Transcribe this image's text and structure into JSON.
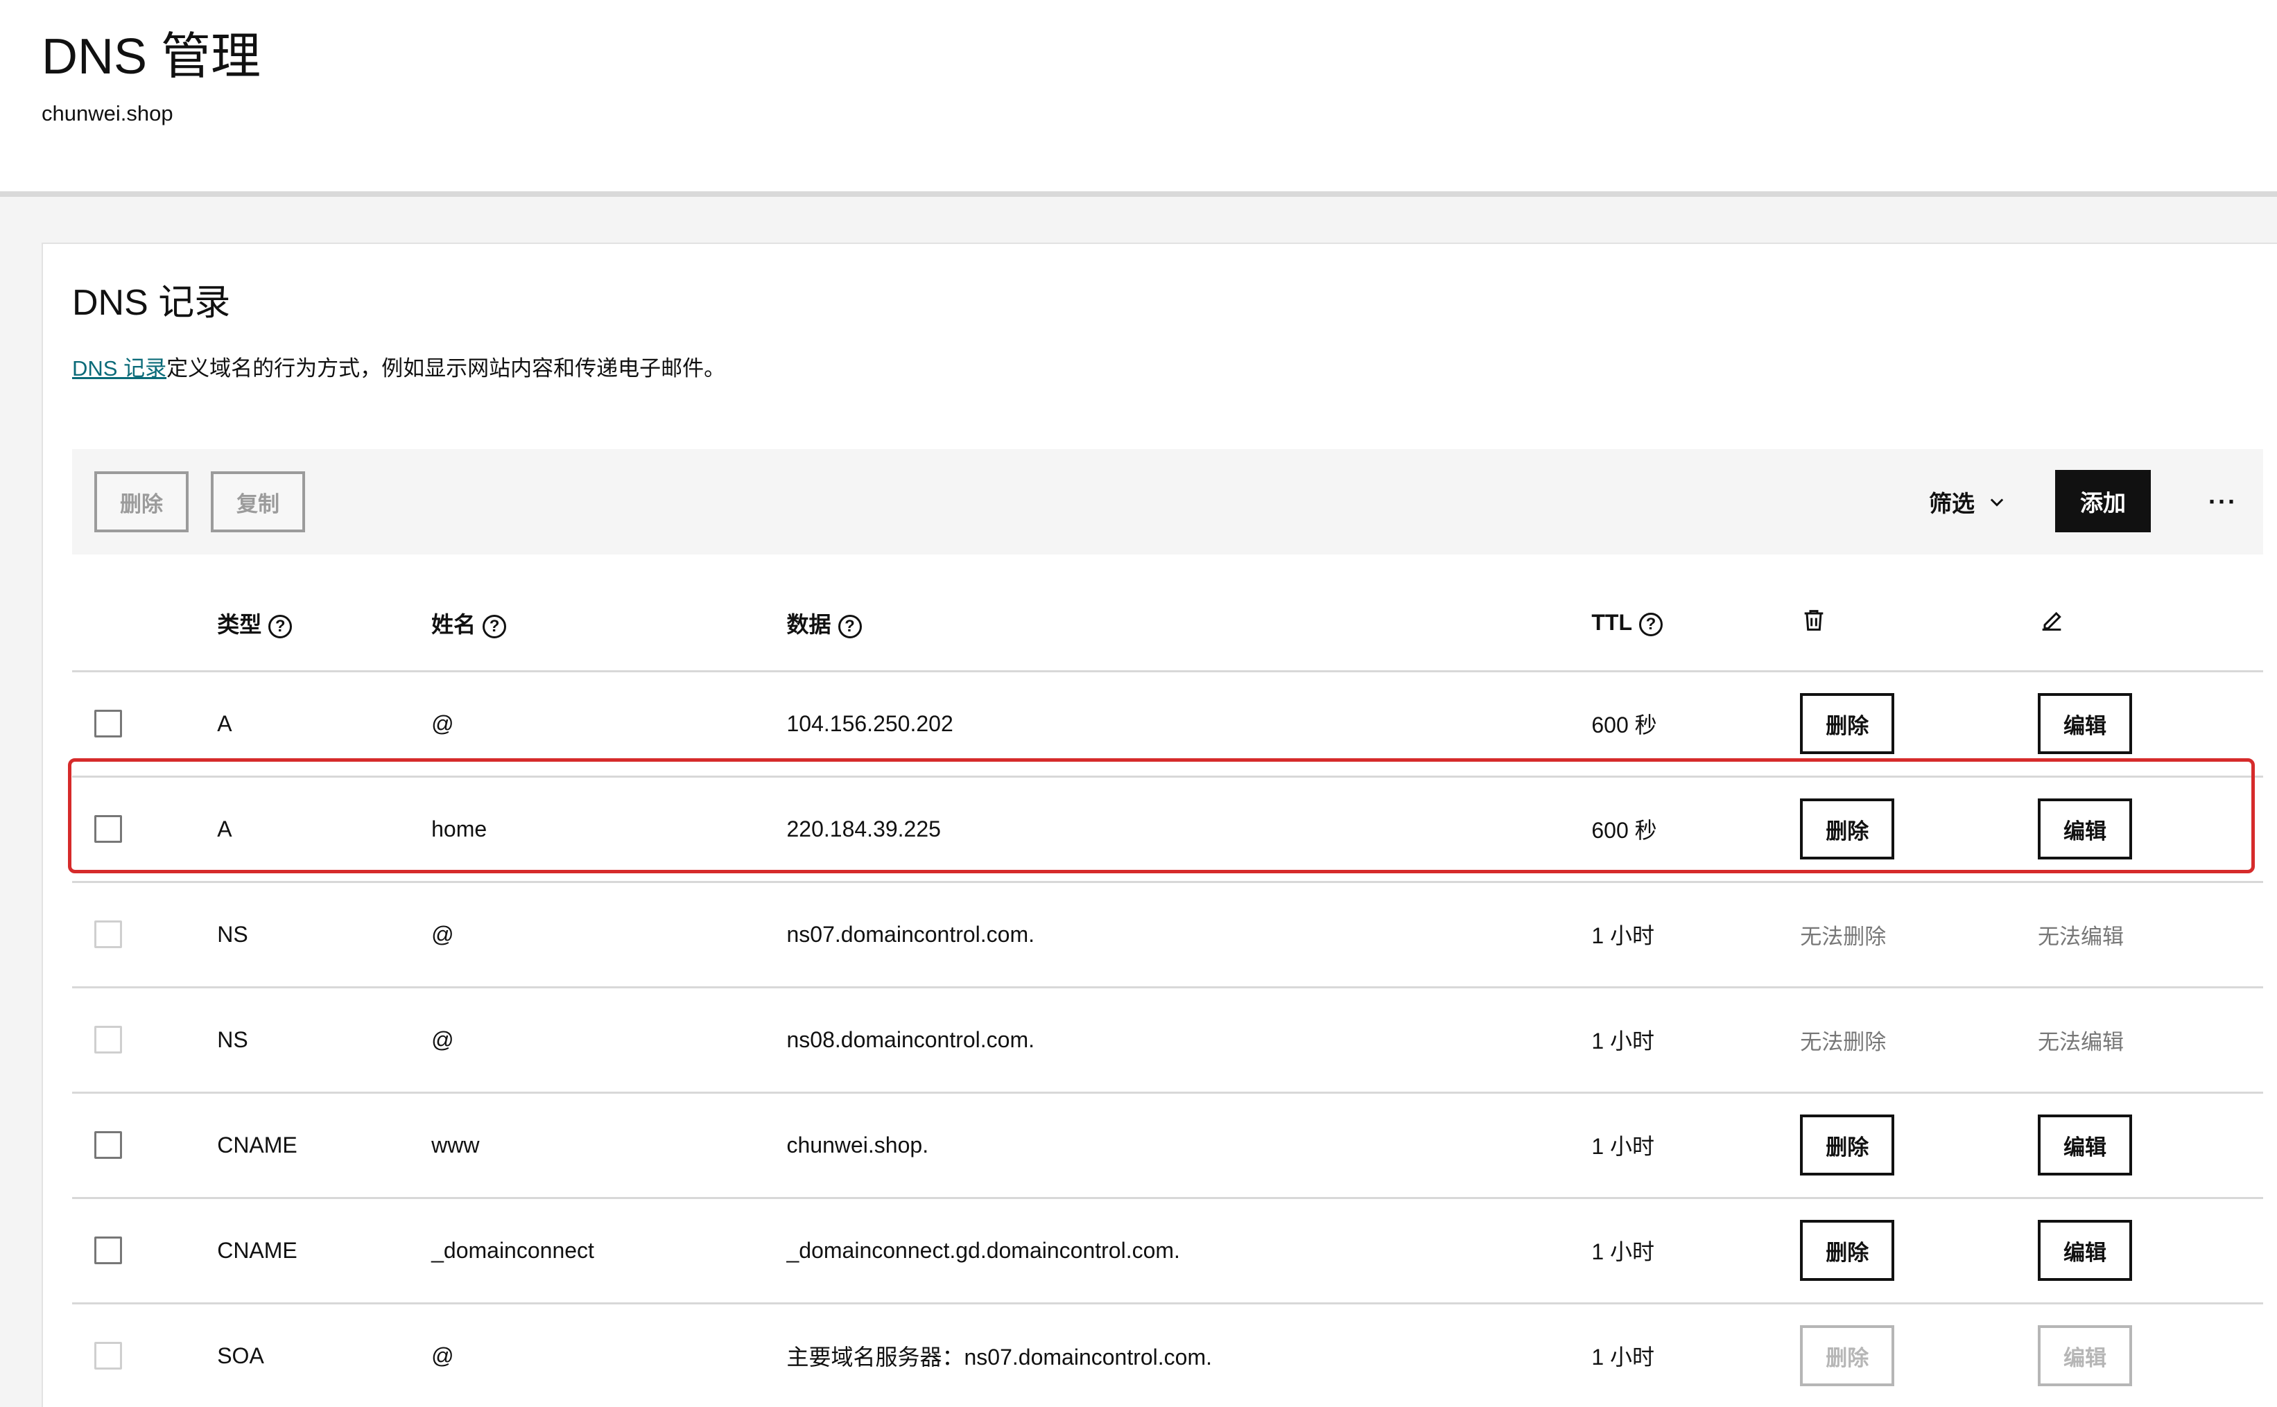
{
  "header": {
    "title": "DNS 管理",
    "domain": "chunwei.shop"
  },
  "section": {
    "title": "DNS 记录",
    "desc_link": "DNS 记录",
    "desc_text": "定义域名的行为方式，例如显示网站内容和传递电子邮件。"
  },
  "toolbar": {
    "delete_label": "删除",
    "copy_label": "复制",
    "filter_label": "筛选",
    "add_label": "添加",
    "more_label": "···"
  },
  "table": {
    "headers": {
      "type": "类型",
      "name": "姓名",
      "data": "数据",
      "ttl": "TTL",
      "help": "?"
    },
    "rows": [
      {
        "type": "A",
        "name": "@",
        "data": "104.156.250.202",
        "ttl": "600 秒",
        "delete": "删除",
        "edit": "编辑"
      },
      {
        "type": "A",
        "name": "home",
        "data": "220.184.39.225",
        "ttl": "600 秒",
        "delete": "删除",
        "edit": "编辑"
      },
      {
        "type": "NS",
        "name": "@",
        "data": "ns07.domaincontrol.com.",
        "ttl": "1 小时",
        "delete": "无法删除",
        "edit": "无法编辑"
      },
      {
        "type": "NS",
        "name": "@",
        "data": "ns08.domaincontrol.com.",
        "ttl": "1 小时",
        "delete": "无法删除",
        "edit": "无法编辑"
      },
      {
        "type": "CNAME",
        "name": "www",
        "data": "chunwei.shop.",
        "ttl": "1 小时",
        "delete": "删除",
        "edit": "编辑"
      },
      {
        "type": "CNAME",
        "name": "_domainconnect",
        "data": "_domainconnect.gd.domaincontrol.com.",
        "ttl": "1 小时",
        "delete": "删除",
        "edit": "编辑"
      },
      {
        "type": "SOA",
        "name": "@",
        "data": "主要域名服务器：ns07.domaincontrol.com.",
        "ttl": "1 小时",
        "delete": "删除",
        "edit": "编辑"
      }
    ]
  },
  "colors": {
    "link": "#0b6b79",
    "highlight": "#d62b2b",
    "primary_button": "#111111"
  }
}
